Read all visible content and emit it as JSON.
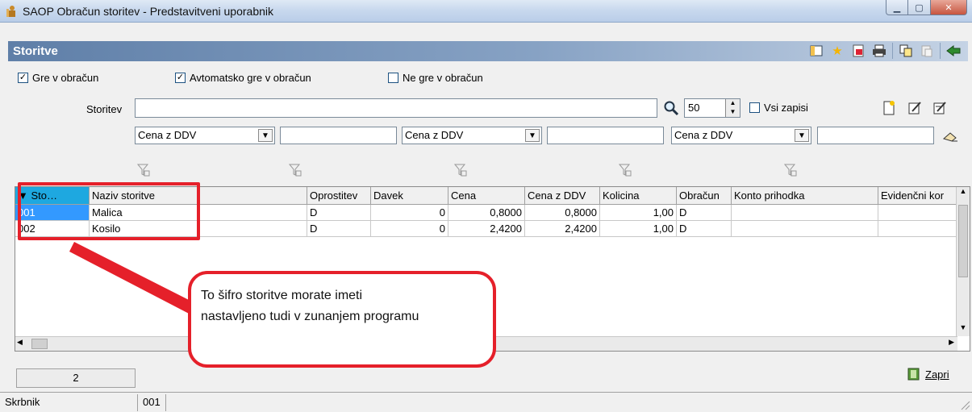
{
  "window": {
    "title": "SAOP Obračun storitev - Predstavitveni uporabnik"
  },
  "header": {
    "title": "Storitve"
  },
  "filters": {
    "gre_v_obracun": {
      "label": "Gre v obračun",
      "checked": true
    },
    "avtomatsko": {
      "label": "Avtomatsko gre v obračun",
      "checked": true
    },
    "ne_gre": {
      "label": "Ne gre v obračun",
      "checked": false
    }
  },
  "search": {
    "label": "Storitev",
    "value": "",
    "page_size": "50",
    "vsi_zapisi": "Vsi zapisi",
    "combo1": "Cena z DDV",
    "combo2": "Cena z DDV",
    "combo3": "Cena z DDV"
  },
  "grid": {
    "columns": [
      "▼ Sto…",
      "Naziv storitve",
      "Oprostitev",
      "Davek",
      "Cena",
      "Cena z DDV",
      "Kolicina",
      "Obračun",
      "Konto prihodka",
      "Evidenčni kor"
    ],
    "rows": [
      [
        "001",
        "Malica",
        "D",
        "0",
        "0,8000",
        "0,8000",
        "1,00",
        "D",
        "",
        ""
      ],
      [
        "002",
        "Kosilo",
        "D",
        "0",
        "2,4200",
        "2,4200",
        "1,00",
        "D",
        "",
        ""
      ]
    ]
  },
  "callout": {
    "line1": "To šifro storitve morate imeti",
    "line2": "nastavljeno tudi v zunanjem programu"
  },
  "footer": {
    "count": "2",
    "close_label": "Zapri"
  },
  "statusbar": {
    "label": "Skrbnik",
    "value": "001"
  },
  "colors": {
    "accent": "#1ea8e0",
    "callout": "#e5202a",
    "header_start": "#5f7fa8"
  }
}
